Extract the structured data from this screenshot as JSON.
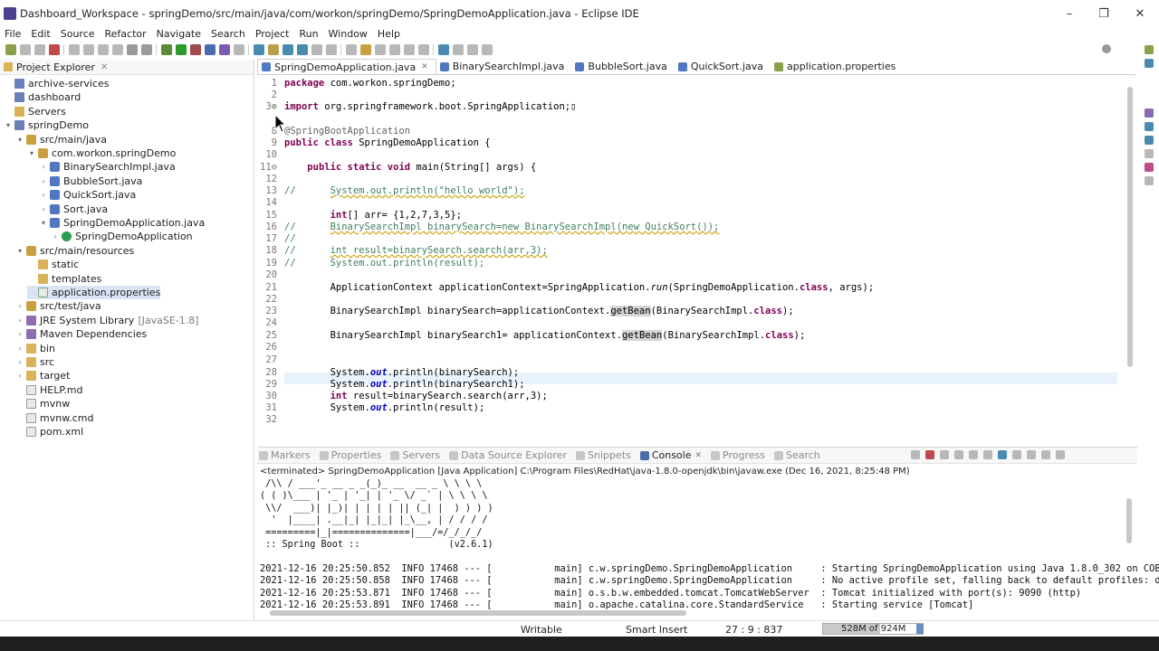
{
  "window": {
    "title": "Dashboard_Workspace - springDemo/src/main/java/com/workon/springDemo/SpringDemoApplication.java - Eclipse IDE",
    "controls": [
      "–",
      "❐",
      "✕"
    ]
  },
  "menu": [
    "File",
    "Edit",
    "Source",
    "Refactor",
    "Navigate",
    "Search",
    "Project",
    "Run",
    "Window",
    "Help"
  ],
  "explorer": {
    "title": "Project Explorer",
    "items": [
      {
        "label": "archive-services",
        "depth": 0,
        "twisty": "",
        "icon": "project"
      },
      {
        "label": "dashboard",
        "depth": 0,
        "twisty": "",
        "icon": "project"
      },
      {
        "label": "Servers",
        "depth": 0,
        "twisty": "",
        "icon": "folder"
      },
      {
        "label": "springDemo",
        "depth": 0,
        "twisty": "▾",
        "icon": "project"
      },
      {
        "label": "src/main/java",
        "depth": 1,
        "twisty": "▾",
        "icon": "pkg"
      },
      {
        "label": "com.workon.springDemo",
        "depth": 2,
        "twisty": "▾",
        "icon": "pkg"
      },
      {
        "label": "BinarySearchImpl.java",
        "depth": 3,
        "twisty": "›",
        "icon": "java"
      },
      {
        "label": "BubbleSort.java",
        "depth": 3,
        "twisty": "›",
        "icon": "java"
      },
      {
        "label": "QuickSort.java",
        "depth": 3,
        "twisty": "›",
        "icon": "java"
      },
      {
        "label": "Sort.java",
        "depth": 3,
        "twisty": "›",
        "icon": "java"
      },
      {
        "label": "SpringDemoApplication.java",
        "depth": 3,
        "twisty": "▾",
        "icon": "java"
      },
      {
        "label": "SpringDemoApplication",
        "depth": 4,
        "twisty": "›",
        "icon": "class"
      },
      {
        "label": "src/main/resources",
        "depth": 1,
        "twisty": "▾",
        "icon": "pkg"
      },
      {
        "label": "static",
        "depth": 2,
        "twisty": "",
        "icon": "folder"
      },
      {
        "label": "templates",
        "depth": 2,
        "twisty": "",
        "icon": "folder"
      },
      {
        "label": "application.properties",
        "depth": 2,
        "twisty": "",
        "icon": "prop",
        "selected": true
      },
      {
        "label": "src/test/java",
        "depth": 1,
        "twisty": "›",
        "icon": "pkg"
      },
      {
        "label": "JRE System Library",
        "suffix": "[JavaSE-1.8]",
        "depth": 1,
        "twisty": "›",
        "icon": "lib"
      },
      {
        "label": "Maven Dependencies",
        "depth": 1,
        "twisty": "›",
        "icon": "lib"
      },
      {
        "label": "bin",
        "depth": 1,
        "twisty": "›",
        "icon": "folder"
      },
      {
        "label": "src",
        "depth": 1,
        "twisty": "›",
        "icon": "folder"
      },
      {
        "label": "target",
        "depth": 1,
        "twisty": "›",
        "icon": "folder"
      },
      {
        "label": "HELP.md",
        "depth": 1,
        "twisty": "",
        "icon": "file"
      },
      {
        "label": "mvnw",
        "depth": 1,
        "twisty": "",
        "icon": "file"
      },
      {
        "label": "mvnw.cmd",
        "depth": 1,
        "twisty": "",
        "icon": "file"
      },
      {
        "label": "pom.xml",
        "depth": 1,
        "twisty": "",
        "icon": "file"
      }
    ]
  },
  "editor": {
    "tabs": [
      {
        "label": "SpringDemoApplication.java",
        "active": true
      },
      {
        "label": "BinarySearchImpl.java"
      },
      {
        "label": "BubbleSort.java"
      },
      {
        "label": "QuickSort.java"
      },
      {
        "label": "application.properties"
      }
    ],
    "lines": [
      {
        "n": "1",
        "segs": [
          [
            "kw",
            "package "
          ],
          [
            "",
            "com.workon.springDemo;"
          ]
        ]
      },
      {
        "n": "2",
        "segs": []
      },
      {
        "n": "3⊕",
        "segs": [
          [
            "kw",
            "import "
          ],
          [
            "",
            "org.springframework.boot.SpringApplication;▯"
          ]
        ]
      },
      {
        "n": "",
        "segs": []
      },
      {
        "n": "8",
        "segs": [
          [
            "ann",
            "@SpringBootApplication"
          ]
        ]
      },
      {
        "n": "9",
        "segs": [
          [
            "kw",
            "public class "
          ],
          [
            "",
            "SpringDemoApplication {"
          ]
        ]
      },
      {
        "n": "10",
        "segs": []
      },
      {
        "n": "11⊖",
        "segs": [
          [
            "",
            "    "
          ],
          [
            "kw",
            "public static void "
          ],
          [
            "",
            "main(String[] args) {"
          ]
        ]
      },
      {
        "n": "12",
        "segs": []
      },
      {
        "n": "13",
        "segs": [
          [
            "cm",
            "//      "
          ],
          [
            "cmw",
            "System.out.println(\"hello world\");"
          ]
        ]
      },
      {
        "n": "14",
        "segs": []
      },
      {
        "n": "15",
        "segs": [
          [
            "",
            "        "
          ],
          [
            "kw",
            "int"
          ],
          [
            "",
            "[] arr= {1,2,7,3,5};"
          ]
        ]
      },
      {
        "n": "16",
        "segs": [
          [
            "cm",
            "//      "
          ],
          [
            "cmw",
            "BinarySearchImpl binarySearch=new BinarySearchImpl(new QuickSort());"
          ]
        ]
      },
      {
        "n": "17",
        "segs": [
          [
            "cm",
            "//"
          ]
        ]
      },
      {
        "n": "18",
        "segs": [
          [
            "cm",
            "//      "
          ],
          [
            "cmw",
            "int result=binarySearch.search(arr,3);"
          ]
        ]
      },
      {
        "n": "19",
        "segs": [
          [
            "cm",
            "//      System.out.println(result);"
          ]
        ]
      },
      {
        "n": "20",
        "segs": []
      },
      {
        "n": "21",
        "segs": [
          [
            "",
            "        ApplicationContext applicationContext=SpringApplication."
          ],
          [
            "fldi",
            "run"
          ],
          [
            "",
            "(SpringDemoApplication."
          ],
          [
            "kw",
            "class"
          ],
          [
            "",
            ", args);"
          ]
        ]
      },
      {
        "n": "22",
        "segs": []
      },
      {
        "n": "23",
        "segs": [
          [
            "",
            "        BinarySearchImpl binarySearch=applicationContext."
          ],
          [
            "hl",
            "getBean"
          ],
          [
            "",
            "(BinarySearchImpl."
          ],
          [
            "kw",
            "class"
          ],
          [
            "",
            ");"
          ]
        ]
      },
      {
        "n": "24",
        "segs": []
      },
      {
        "n": "25",
        "segs": [
          [
            "",
            "        BinarySearchImpl binarySearch1= applicationContext."
          ],
          [
            "hl",
            "getBean"
          ],
          [
            "",
            "(BinarySearchImpl."
          ],
          [
            "kw",
            "class"
          ],
          [
            "",
            ");"
          ]
        ]
      },
      {
        "n": "26",
        "segs": []
      },
      {
        "n": "27",
        "segs": []
      },
      {
        "n": "28",
        "segs": [
          [
            "",
            "        System."
          ],
          [
            "fld",
            "out"
          ],
          [
            "",
            ".println(binarySearch);"
          ]
        ]
      },
      {
        "n": "29",
        "segs": [
          [
            "",
            "        System."
          ],
          [
            "fld",
            "out"
          ],
          [
            "",
            ".println(binarySearch1);"
          ]
        ]
      },
      {
        "n": "30",
        "segs": [
          [
            "",
            "        "
          ],
          [
            "kw",
            "int "
          ],
          [
            "",
            "result=binarySearch.search(arr,3);"
          ]
        ]
      },
      {
        "n": "31",
        "segs": [
          [
            "",
            "        System."
          ],
          [
            "fld",
            "out"
          ],
          [
            "",
            ".println(result);"
          ]
        ]
      },
      {
        "n": "32",
        "segs": []
      }
    ]
  },
  "console": {
    "tabs": [
      {
        "label": "Markers"
      },
      {
        "label": "Properties"
      },
      {
        "label": "Servers"
      },
      {
        "label": "Data Source Explorer"
      },
      {
        "label": "Snippets"
      },
      {
        "label": "Console",
        "active": true
      },
      {
        "label": "Progress"
      },
      {
        "label": "Search"
      }
    ],
    "terminated": "<terminated> SpringDemoApplication [Java Application] C:\\Program Files\\RedHat\\java-1.8.0-openjdk\\bin\\javaw.exe (Dec 16, 2021, 8:25:48 PM)",
    "lines": [
      " /\\\\ / ___'_ __ _ _(_)_ __  __ _ \\ \\ \\ \\",
      "( ( )\\___ | '_ | '_| | '_ \\/ _` | \\ \\ \\ \\",
      " \\\\/  ___)| |_)| | | | | || (_| |  ) ) ) )",
      "  '  |____| .__|_| |_|_| |_\\__, | / / / /",
      " =========|_|==============|___/=/_/_/_/",
      " :: Spring Boot ::                (v2.6.1)",
      "",
      "2021-12-16 20:25:50.852  INFO 17468 --- [           main] c.w.springDemo.SpringDemoApplication     : Starting SpringDemoApplication using Java 1.8.0_302 on COB",
      "2021-12-16 20:25:50.858  INFO 17468 --- [           main] c.w.springDemo.SpringDemoApplication     : No active profile set, falling back to default profiles: d",
      "2021-12-16 20:25:53.871  INFO 17468 --- [           main] o.s.b.w.embedded.tomcat.TomcatWebServer  : Tomcat initialized with port(s): 9090 (http)",
      "2021-12-16 20:25:53.891  INFO 17468 --- [           main] o.apache.catalina.core.StandardService   : Starting service [Tomcat]"
    ]
  },
  "status": {
    "writable": "Writable",
    "insert": "Smart Insert",
    "position": "27 : 9 : 837",
    "heap": "528M of 924M",
    "heap_fraction": 0.571
  }
}
